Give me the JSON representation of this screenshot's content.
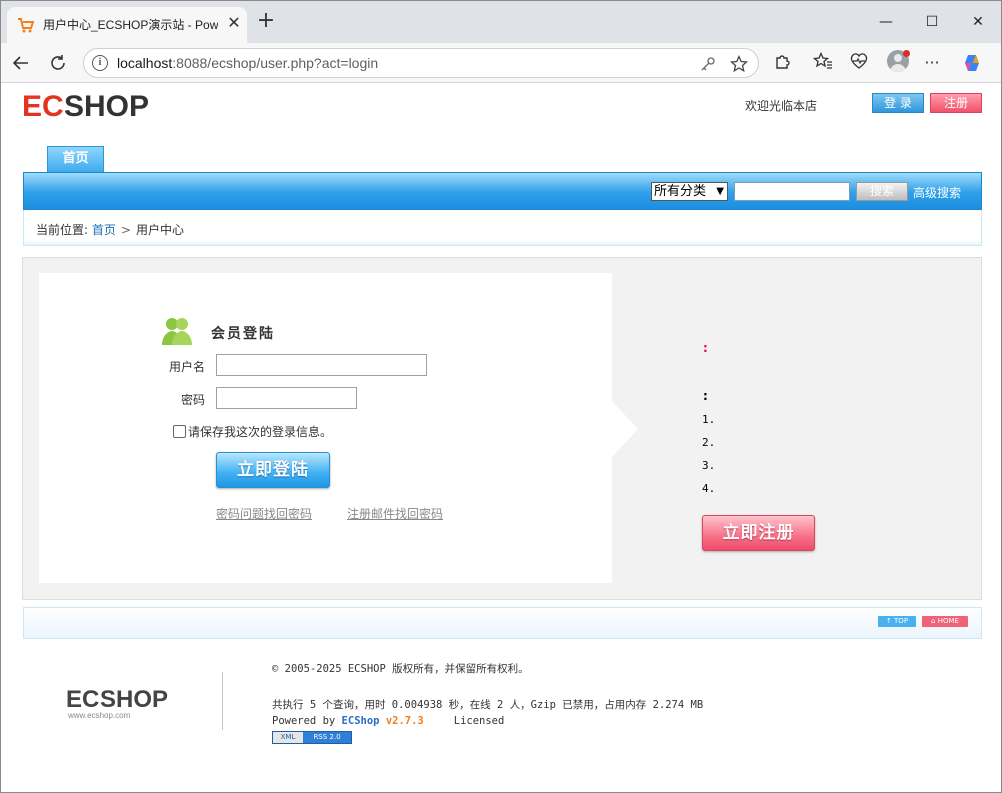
{
  "browser": {
    "tab_title": "用户中心_ECSHOP演示站 - Powered by ECShop",
    "tab_close": "✕",
    "new_tab": "+",
    "url_host": "localhost",
    "url_rest": ":8088/ecshop/user.php?act=login",
    "win_min": "—",
    "win_max": "☐",
    "win_close": "✕"
  },
  "header": {
    "logo_alt": "ECSHOP",
    "welcome": "欢迎光临本店",
    "login_label": "登 录",
    "register_label": "注册"
  },
  "nav": {
    "home_tab": "首页",
    "category_select": "所有分类",
    "search_button": "搜索",
    "advanced_search": "高级搜索"
  },
  "breadcrumb": {
    "prefix": "当前位置:",
    "home": "首页",
    "separator": ">",
    "current": "用户中心"
  },
  "login": {
    "title": "会员登陆",
    "username_label": "用户名",
    "username_value": "",
    "password_label": "密码",
    "password_value": "",
    "remember_label": "请保存我这次的登录信息。",
    "submit_label": "立即登陆",
    "forgot_question": "密码问题找回密码",
    "forgot_email": "注册邮件找回密码"
  },
  "side": {
    "colon_red": ":",
    "colon": ":",
    "items": [
      "1.",
      "2.",
      "3.",
      "4."
    ],
    "register_button": "立即注册"
  },
  "footer_bar": {
    "top": "↑ TOP",
    "home": "⌂ HOME"
  },
  "footer": {
    "copyright": "© 2005-2025 ECSHOP 版权所有，并保留所有权利。",
    "stats": "共执行 5 个查询，用时 0.004938 秒，在线 2 人，Gzip 已禁用，占用内存 2.274 MB",
    "powered_prefix": "Powered by ",
    "powered_brand": "ECShop",
    "powered_version": "v2.7.3",
    "license": "Licensed",
    "xml": "XML",
    "rss": "RSS 2.0"
  },
  "colors": {
    "accent_blue": "#2e9fe9",
    "accent_pink": "#f0516a",
    "brand_orange": "#f47e20"
  }
}
